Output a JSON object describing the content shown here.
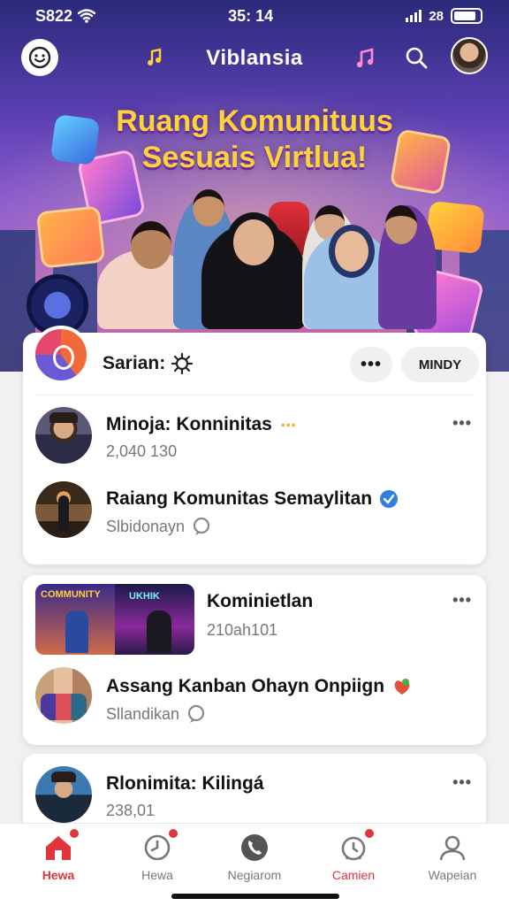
{
  "status_bar": {
    "time_left": "S822",
    "time_center": "35: 14",
    "right_text": "28"
  },
  "app_bar": {
    "title": "Viblansia"
  },
  "banner": {
    "line1": "Ruang Komunituus",
    "line2": "Sesuais Virtlua!"
  },
  "card1": {
    "title": "Sarian:",
    "more_label": "•••",
    "join_label": "MINDY",
    "rows": [
      {
        "title": "Minoja: Konninitas",
        "sub": "2,040 130"
      },
      {
        "title": "Raiang Komunitas Semaylitan",
        "sub": "Slbidonayn"
      }
    ]
  },
  "card2": {
    "rows": [
      {
        "title": "Kominietlan",
        "sub": "210ah101",
        "thumb_text_a": "COMMUNITY",
        "thumb_text_b": "UKHIK"
      },
      {
        "title": "Assang Kanban Ohayn Onpiign",
        "sub": "Sllandikan"
      }
    ]
  },
  "card3": {
    "rows": [
      {
        "title": "Rlonimita: Kilingá",
        "sub": "238,01"
      }
    ]
  },
  "row_more": "•••",
  "bottom_nav": {
    "items": [
      {
        "label": "Hewa",
        "active": true
      },
      {
        "label": "Hewa",
        "active": false
      },
      {
        "label": "Negiarom",
        "active": false
      },
      {
        "label": "Camien",
        "active": false
      },
      {
        "label": "Wapeian",
        "active": false
      }
    ]
  },
  "colors": {
    "accent": "#e0353d",
    "hero_top": "#2a2a7a",
    "hero_bottom": "#d06a9a",
    "headline": "#ffd23c"
  },
  "icons": [
    "smiley-icon",
    "music-note-icon",
    "search-icon",
    "home-icon",
    "clock-icon",
    "phone-icon",
    "alarm-icon",
    "person-icon",
    "verified-icon",
    "gear-icon",
    "chat-icon"
  ]
}
